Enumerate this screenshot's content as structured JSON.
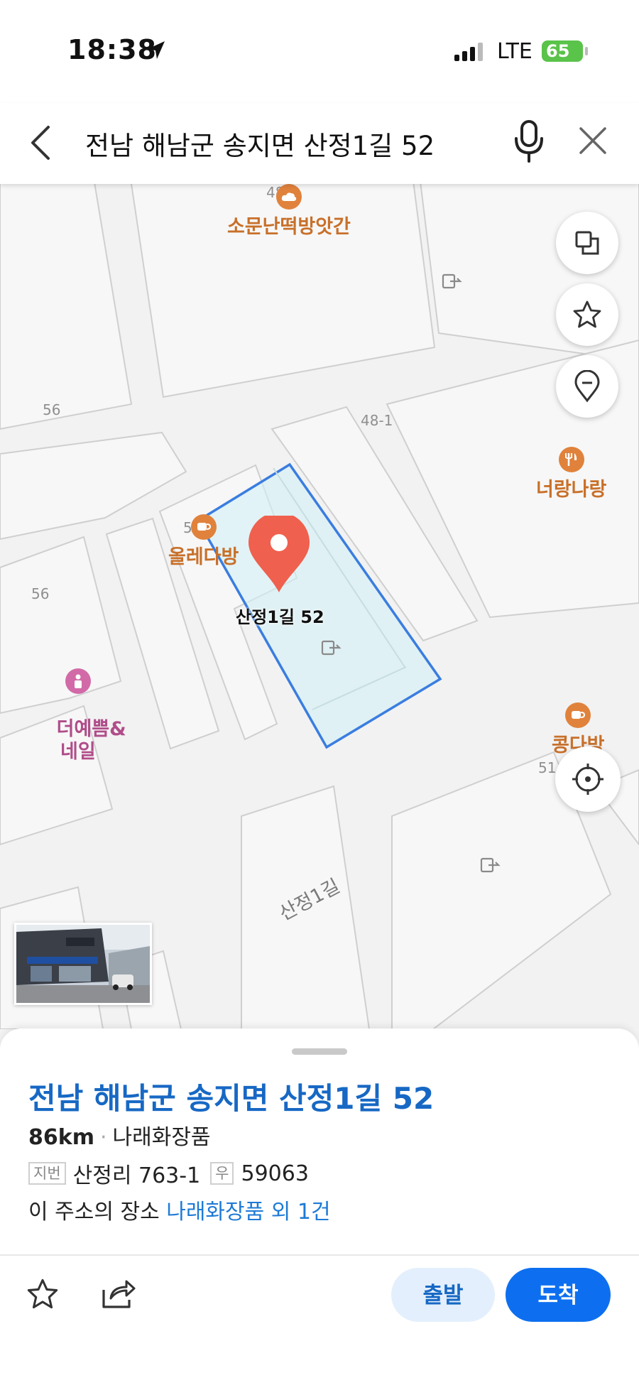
{
  "status_bar": {
    "time": "18:38",
    "network": "LTE",
    "battery": "65"
  },
  "search": {
    "query": "전남 해남군 송지면 산정1길 52"
  },
  "map": {
    "pois": [
      {
        "name": "소문난떡방앗간",
        "color": "#c8702a",
        "icon": "cloud-icon"
      },
      {
        "name": "너랑나랑",
        "color": "#c8702a",
        "icon": "restaurant-icon"
      },
      {
        "name": "올레다방",
        "color": "#c8702a",
        "icon": "cafe-icon"
      },
      {
        "name": "더예쁨&\n네일",
        "color": "#b04d8a",
        "icon": "beauty-icon"
      },
      {
        "name": "콩다방",
        "color": "#c8702a",
        "icon": "cafe-icon"
      }
    ],
    "building_numbers": [
      "48",
      "56",
      "48-1",
      "5",
      "56",
      "51"
    ],
    "selected_label": "산정1길 52",
    "road_name": "산정1길",
    "pin_color": "#f0604e",
    "highlight_color": "#3a7de0"
  },
  "place": {
    "title": "전남 해남군 송지면 산정1길 52",
    "distance": "86km",
    "category": "나래화장품",
    "jibun_tag": "지번",
    "jibun": "산정리 763-1",
    "postal_tag": "우",
    "postal": "59063",
    "places_prefix": "이 주소의 장소",
    "places_link": "나래화장품 외 1건"
  },
  "actions": {
    "depart": "출발",
    "arrive": "도착"
  }
}
